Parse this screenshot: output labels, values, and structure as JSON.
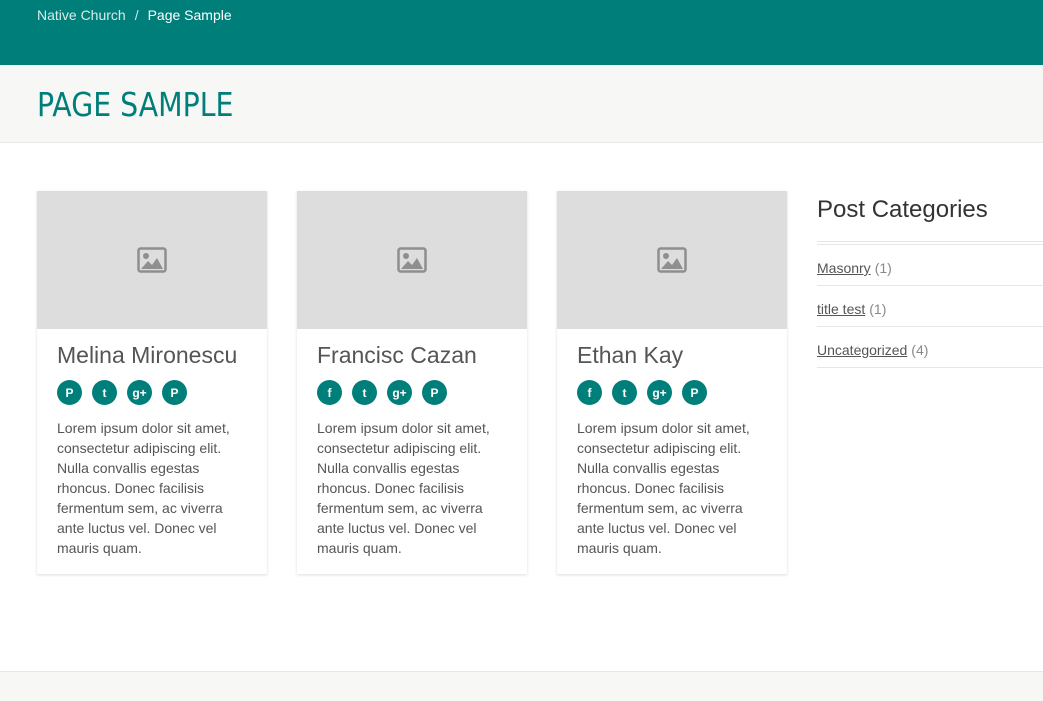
{
  "breadcrumb": {
    "home": "Native Church",
    "separator": "/",
    "current": "Page Sample"
  },
  "page_title": "PAGE SAMPLE",
  "cards": [
    {
      "name": "Melina Mironescu",
      "socials": [
        "pinterest",
        "twitter",
        "google-plus",
        "pinterest"
      ],
      "description": "Lorem ipsum dolor sit amet, consectetur adipiscing elit. Nulla convallis egestas rhoncus. Donec facilisis fermentum sem, ac viverra ante luctus vel. Donec vel mauris quam."
    },
    {
      "name": "Francisc Cazan",
      "socials": [
        "facebook",
        "twitter",
        "google-plus",
        "pinterest"
      ],
      "description": "Lorem ipsum dolor sit amet, consectetur adipiscing elit. Nulla convallis egestas rhoncus. Donec facilisis fermentum sem, ac viverra ante luctus vel. Donec vel mauris quam."
    },
    {
      "name": "Ethan Kay",
      "socials": [
        "facebook",
        "twitter",
        "google-plus",
        "pinterest"
      ],
      "description": "Lorem ipsum dolor sit amet, consectetur adipiscing elit. Nulla convallis egestas rhoncus. Donec facilisis fermentum sem, ac viverra ante luctus vel. Donec vel mauris quam."
    }
  ],
  "sidebar": {
    "title": "Post Categories",
    "categories": [
      {
        "name": "Masonry",
        "count": "(1)"
      },
      {
        "name": "title test",
        "count": "(1)"
      },
      {
        "name": "Uncategorized",
        "count": "(4)"
      }
    ]
  },
  "colors": {
    "brand": "#007f7a",
    "thumb": "#dddddd",
    "title_bar": "#f7f7f5"
  },
  "icons": {
    "thumb_placeholder": "image-placeholder-icon"
  }
}
